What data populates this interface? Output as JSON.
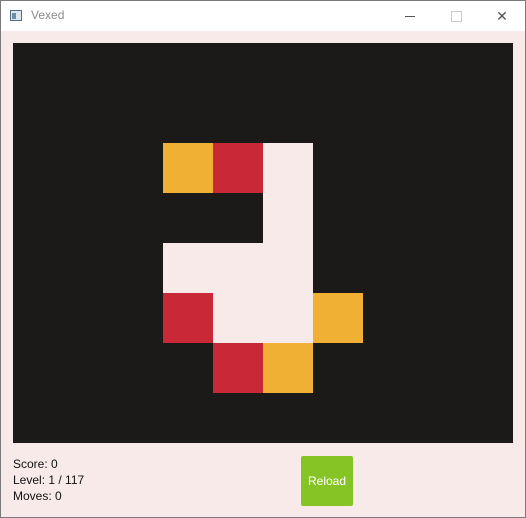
{
  "window": {
    "title": "Vexed",
    "icons": {
      "app": "window-app-icon",
      "minimize": "minimize-icon",
      "maximize": "maximize-icon",
      "close": "close-icon"
    },
    "close_glyph": "✕"
  },
  "board": {
    "cols": 10,
    "rows": 8,
    "legend": {
      ".": "wall",
      "E": "empty",
      "O": "orange-block",
      "R": "red-block"
    },
    "colors": {
      "wall": "#1c1919",
      "empty": "#f8eae8",
      "orange-block": "#f0b033",
      "red-block": "#c92837"
    },
    "grid": [
      "..........",
      "..........",
      "...ORE....",
      ".....E....",
      "...EEE....",
      "...REEO...",
      "....RO....",
      ".........."
    ]
  },
  "status": {
    "score": "Score: 0",
    "level": "Level: 1 / 117",
    "moves": "Moves: 0"
  },
  "controls": {
    "reload_label": "Reload",
    "reload_color": "#86c426"
  }
}
